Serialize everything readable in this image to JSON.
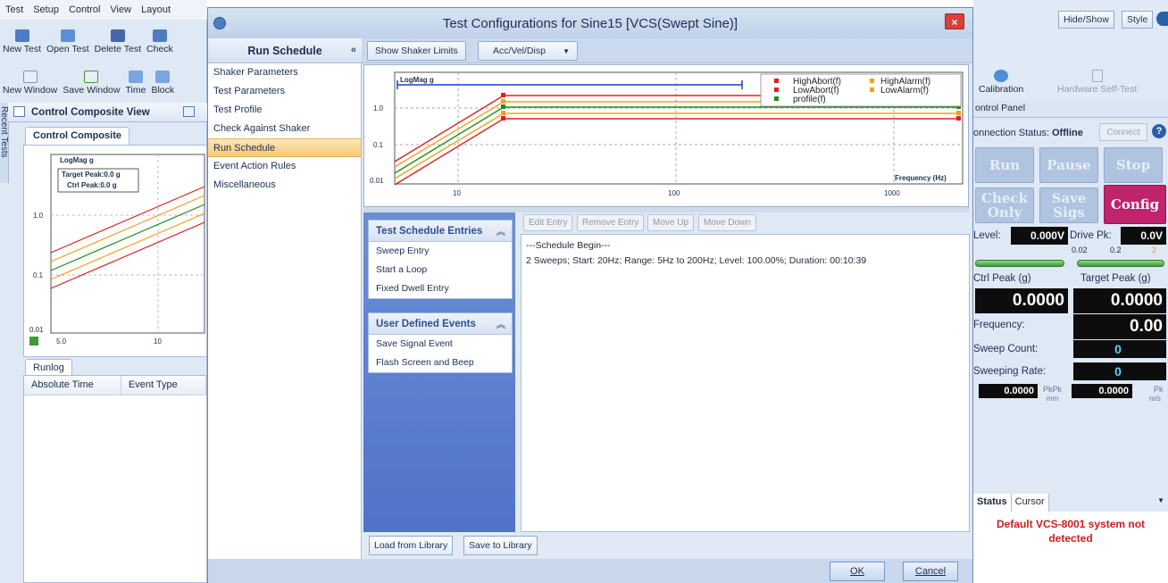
{
  "left_app": {
    "menu": [
      "Test",
      "Setup",
      "Control",
      "View",
      "Layout"
    ],
    "ribbon_row1": [
      "New Test",
      "Open Test",
      "Delete Test",
      "Check"
    ],
    "ribbon_row2": [
      "New Window",
      "Save Window",
      "Time",
      "Block"
    ],
    "view_title": "Control Composite View",
    "recent_tests": "Recent Tests",
    "doc_tab": "Control Composite",
    "mini_chart": {
      "label": "LogMag g",
      "target_peak": "Target Peak:0.0 g",
      "ctrl_peak": "Ctrl Peak:0.0 g",
      "y_ticks": [
        "1.0",
        "0.1",
        "0.01"
      ],
      "x_ticks": [
        "5.0",
        "10"
      ]
    },
    "runlog_tab": "Runlog",
    "runlog_columns": [
      "Absolute Time",
      "Event Type"
    ]
  },
  "dialog": {
    "title": "Test Configurations for Sine15 [VCS(Swept Sine)]",
    "close": "×",
    "nav_title": "Run Schedule",
    "nav_collapse": "«",
    "nav_items": [
      "Shaker Parameters",
      "Test Parameters",
      "Test Profile",
      "Check Against Shaker",
      "Run Schedule",
      "Event Action Rules",
      "Miscellaneous"
    ],
    "toolbar": {
      "show_limits": "Show Shaker Limits",
      "units": "Acc/Vel/Disp"
    },
    "chart": {
      "label": "LogMag g",
      "x_label": "Frequency (Hz)",
      "y_ticks": [
        "1.0",
        "0.1",
        "0.01"
      ],
      "x_ticks": [
        "10",
        "100",
        "1000"
      ],
      "legend": [
        "HighAbort(f)",
        "HighAlarm(f)",
        "LowAbort(f)",
        "LowAlarm(f)",
        "profile(f)"
      ],
      "colors": {
        "abort": "#e02020",
        "alarm": "#f0a020",
        "profile": "#1e8a1e",
        "limit": "#1a3fc8"
      }
    },
    "schedule_groups": {
      "entries_title": "Test Schedule Entries",
      "entries": [
        "Sweep Entry",
        "Start a Loop",
        "Fixed Dwell Entry"
      ],
      "events_title": "User Defined Events",
      "events": [
        "Save Signal Event",
        "Flash Screen and Beep"
      ]
    },
    "schedule_tools": [
      "Edit Entry",
      "Remove Entry",
      "Move Up",
      "Move Down"
    ],
    "schedule_lines": [
      "---Schedule Begin---",
      "2 Sweeps; Start: 20Hz; Range: 5Hz to 200Hz; Level: 100.00%; Duration: 00:10:39"
    ],
    "library": {
      "load": "Load from Library",
      "save": "Save to Library"
    },
    "ok": "OK",
    "cancel": "Cancel"
  },
  "right_app": {
    "hide_show": "Hide/Show",
    "style": "Style",
    "calibration": "Calibration",
    "hardware_test": "Hardware Self-Test",
    "control_panel": "ontrol Panel",
    "connection_label": "onnection Status:",
    "connection_value": "Offline",
    "connect": "Connect",
    "buttons": {
      "run": "Run",
      "pause": "Pause",
      "stop": "Stop",
      "check": "Check Only",
      "save": "Save Sigs",
      "config": "Config"
    },
    "level_label": "Level:",
    "level_value": "0.000V",
    "drive_label": "Drive Pk:",
    "drive_value": "0.0V",
    "drive_ticks": [
      "0.02",
      "0.2",
      "2"
    ],
    "ctrl_peak_label": "Ctrl Peak (g)",
    "target_peak_label": "Target Peak (g)",
    "ctrl_peak_value": "0.0000",
    "target_peak_value": "0.0000",
    "frequency_label": "Frequency:",
    "frequency_value": "0.00",
    "sweep_count_label": "Sweep Count:",
    "sweep_count_value": "0",
    "sweep_rate_label": "Sweeping Rate:",
    "sweep_rate_value": "0",
    "pkpk_value": "0.0000",
    "pkpk_unit": "PkPk",
    "pkpk_unit2": "mm",
    "pk_value": "0.0000",
    "pk_unit": "Pk",
    "pk_unit2": "m/s",
    "status_tabs": [
      "Status",
      "Cursor"
    ],
    "status_message": "Default VCS-8001 system not detected"
  }
}
